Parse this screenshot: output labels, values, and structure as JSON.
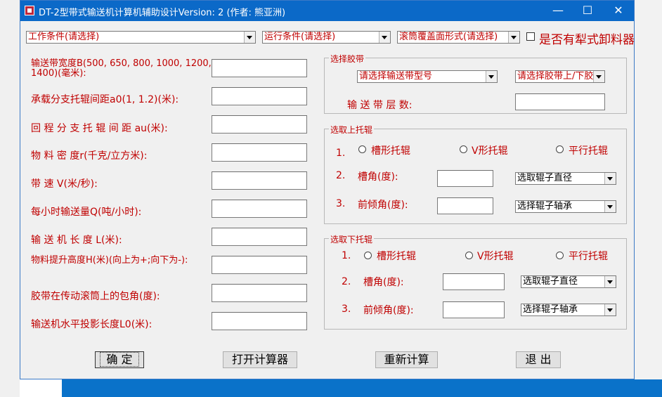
{
  "window": {
    "title": "DT-2型带式输送机计算机辅助设计Version: 2 (作者: 熊亚洲)",
    "controls": {
      "minimize": "—",
      "maximize": "☐",
      "close": "✕"
    }
  },
  "top_combos": {
    "work_condition": "工作条件(请选择)",
    "run_condition": "运行条件(请选择)",
    "drum_cover": "滚筒覆盖面形式(请选择)",
    "plow_label": "是否有犁式卸料器"
  },
  "fields": [
    {
      "label": "输送带宽度B(500, 650, 800, 1000, 1200, 1400)(毫米):",
      "value": ""
    },
    {
      "label": "承载分支托辊间距a0(1, 1.2)(米):",
      "value": ""
    },
    {
      "label": "回 程 分 支 托 辊 间 距 au(米):",
      "value": ""
    },
    {
      "label": "物  料  密  度r(千克/立方米):",
      "value": ""
    },
    {
      "label": "带      速     V(米/秒):",
      "value": ""
    },
    {
      "label": "每小时输送量Q(吨/小时):",
      "value": ""
    },
    {
      "label": "输  送  机  长  度 L(米):",
      "value": ""
    },
    {
      "label": "物料提升高度H(米)(向上为+;向下为-):",
      "value": ""
    },
    {
      "label": "胶带在传动滚筒上的包角(度):",
      "value": ""
    },
    {
      "label": "输送机水平投影长度L0(米):",
      "value": ""
    }
  ],
  "belt_group": {
    "title": "选择胶带",
    "belt_type": "请选择输送带型号",
    "belt_cover": "请选择胶带上/下胶层",
    "layers_label": "输    送    带    层    数:",
    "layers_value": ""
  },
  "upper_idler": {
    "title": "选取上托辊",
    "n1": "1.",
    "n2": "2.",
    "n3": "3.",
    "options": [
      "槽形托辊",
      "V形托辊",
      "平行托辊"
    ],
    "trough_label": "槽角(度):",
    "tilt_label": "前倾角(度):",
    "diameter": "选取辊子直径",
    "bearing": "选择辊子轴承"
  },
  "lower_idler": {
    "title": "选取下托辊",
    "n1": "1.",
    "n2": "2.",
    "n3": "3.",
    "options": [
      "槽形托辊",
      "V形托辊",
      "平行托辊"
    ],
    "trough_label": "槽角(度):",
    "tilt_label": "前倾角(度):",
    "diameter": "选取辊子直径",
    "bearing": "选择辊子轴承"
  },
  "buttons": {
    "ok": "确  定",
    "calc": "打开计算器",
    "recalc": "重新计算",
    "exit": "退  出"
  }
}
